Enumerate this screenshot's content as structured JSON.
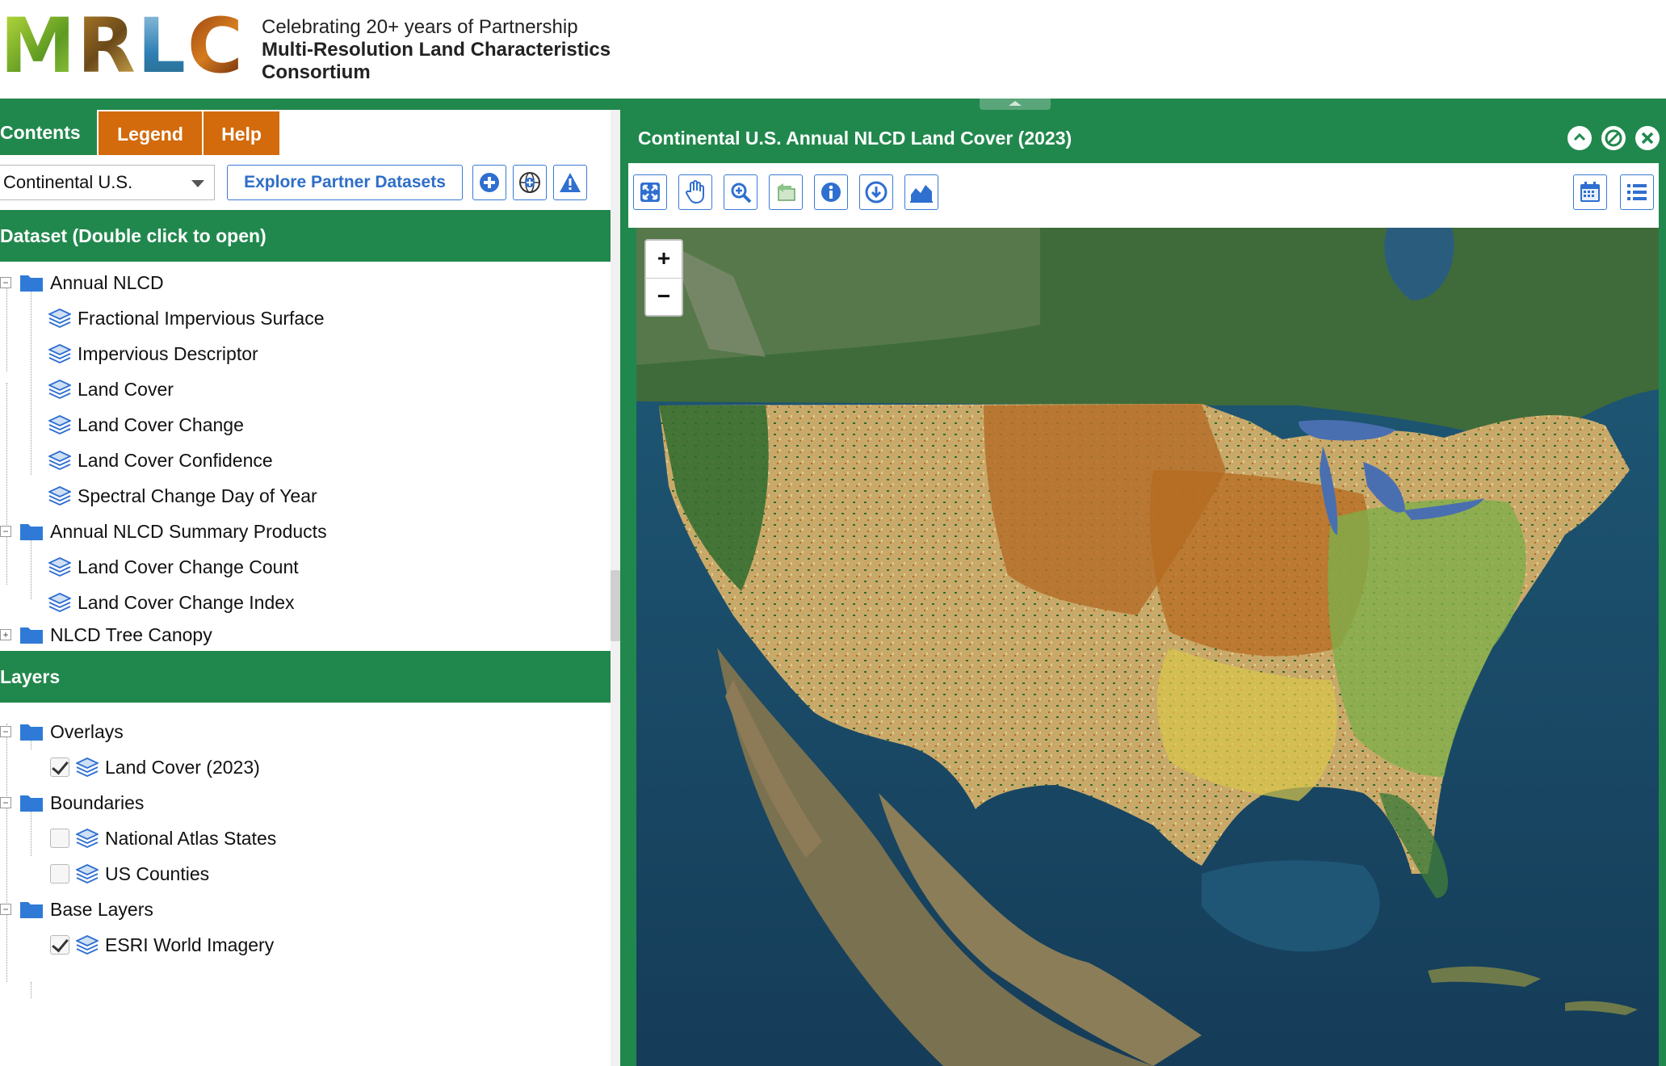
{
  "header": {
    "logo_text": "MRLC",
    "tagline": "Celebrating 20+ years of Partnership",
    "title_line1": "Multi-Resolution Land Characteristics",
    "title_line2": "Consortium"
  },
  "tabs": [
    {
      "label": "Contents"
    },
    {
      "label": "Legend"
    },
    {
      "label": "Help"
    }
  ],
  "controls": {
    "region_value": "Continental U.S.",
    "explore_label": "Explore Partner Datasets",
    "icons": [
      "add-icon",
      "globe-add-icon",
      "warning-icon"
    ]
  },
  "dataset": {
    "heading": "Dataset (Double click to open)",
    "groups": [
      {
        "label": "Annual NLCD",
        "items": [
          "Fractional Impervious Surface",
          "Impervious Descriptor",
          "Land Cover",
          "Land Cover Change",
          "Land Cover Confidence",
          "Spectral Change Day of Year"
        ]
      },
      {
        "label": "Annual NLCD Summary Products",
        "items": [
          "Land Cover Change Count",
          "Land Cover Change Index"
        ]
      },
      {
        "label": "NLCD Tree Canopy",
        "items": []
      }
    ]
  },
  "layers": {
    "heading": "Layers",
    "groups": [
      {
        "label": "Overlays",
        "items": [
          {
            "label": "Land Cover (2023)",
            "checked": true
          }
        ]
      },
      {
        "label": "Boundaries",
        "items": [
          {
            "label": "National Atlas States",
            "checked": false
          },
          {
            "label": "US Counties",
            "checked": false
          }
        ]
      },
      {
        "label": "Base Layers",
        "items": [
          {
            "label": "ESRI World Imagery",
            "checked": true
          }
        ]
      }
    ]
  },
  "map": {
    "title": "Continental U.S. Annual NLCD Land Cover (2023)",
    "zoom_in": "+",
    "zoom_out": "−",
    "tools": [
      "full-extent-icon",
      "pan-icon",
      "zoom-in-icon",
      "previous-extent-icon",
      "identify-icon",
      "download-icon",
      "chart-icon"
    ],
    "right_tools": [
      "calendar-icon",
      "list-icon"
    ],
    "window_buttons": [
      "collapse-icon",
      "restore-icon",
      "close-icon"
    ]
  },
  "colors": {
    "green": "#21884d",
    "orange": "#d36a0b",
    "blue": "#2f6fd0"
  }
}
